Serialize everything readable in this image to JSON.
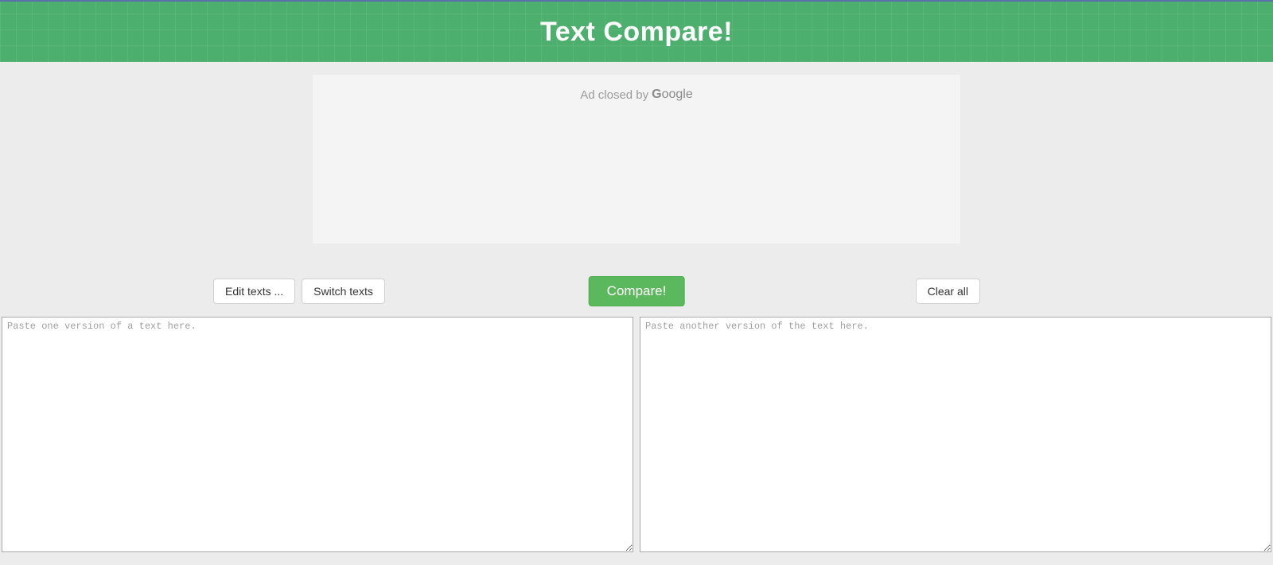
{
  "header": {
    "title": "Text Compare!"
  },
  "ad": {
    "text_prefix": "Ad closed by",
    "brand": "Google"
  },
  "controls": {
    "edit_texts_label": "Edit texts ...",
    "switch_texts_label": "Switch texts",
    "compare_label": "Compare!",
    "clear_all_label": "Clear all"
  },
  "textareas": {
    "left_placeholder": "Paste one version of a text here.",
    "right_placeholder": "Paste another version of the text here.",
    "left_value": "",
    "right_value": ""
  }
}
